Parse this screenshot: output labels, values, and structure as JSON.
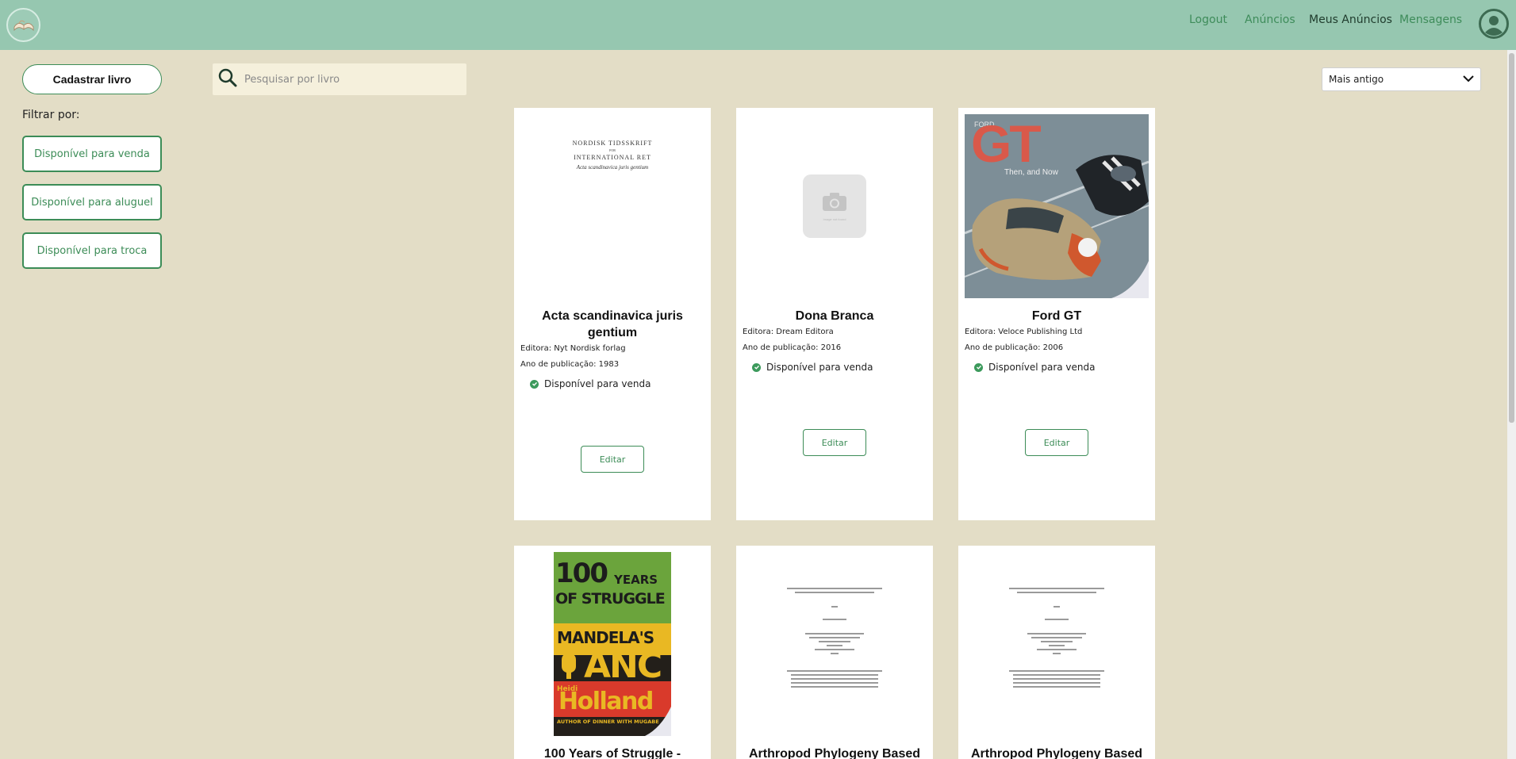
{
  "header": {
    "nav": {
      "logout": "Logout",
      "anuncios": "Anúncios",
      "meus_anuncios": "Meus Anúncios",
      "mensagens": "Mensagens"
    }
  },
  "sidebar": {
    "cadastrar_label": "Cadastrar livro",
    "filter_label": "Filtrar por:",
    "filters": [
      "Disponível para venda",
      "Disponível para aluguel",
      "Disponível para troca"
    ]
  },
  "search": {
    "placeholder": "Pesquisar por livro"
  },
  "sort": {
    "selected": "Mais antigo"
  },
  "cards": [
    {
      "title": "Acta scandinavica juris gentium",
      "editora": "Editora: Nyt Nordisk forlag",
      "ano": "Ano de publicação: 1983",
      "status": "Disponível para venda",
      "edit_label": "Editar",
      "cover": {
        "l1": "NORDISK TIDSSKRIFT",
        "l2": "FOR",
        "l3": "INTERNATIONAL RET",
        "l4": "Acta scandinavica juris gentium"
      }
    },
    {
      "title": "Dona Branca",
      "editora": "Editora: Dream Editora",
      "ano": "Ano de publicação: 2016",
      "status": "Disponível para venda",
      "edit_label": "Editar",
      "cover": {
        "tiny": "Image not found"
      }
    },
    {
      "title": "Ford GT",
      "editora": "Editora: Veloce Publishing Ltd",
      "ano": "Ano de publicação: 2006",
      "status": "Disponível para venda",
      "edit_label": "Editar",
      "cover": {
        "brand": "FORD",
        "big": "GT",
        "sub": "Then, and Now"
      }
    },
    {
      "title": "100 Years of Struggle -",
      "cover": {
        "t1": "100",
        "t2": "YEARS",
        "t3": "OF STRUGGLE",
        "t4": "MANDELA'S",
        "t5": "ANC",
        "t6": "Heidi",
        "t7": "Holland",
        "t8": "AUTHOR OF DINNER WITH MUGABE"
      }
    },
    {
      "title": "Arthropod Phylogeny Based"
    },
    {
      "title": "Arthropod Phylogeny Based"
    }
  ],
  "colors": {
    "header_bg": "#96c7b0",
    "page_bg": "#e3ddc6",
    "accent_green": "#3c8c57",
    "check_green": "#3c9a5c"
  },
  "icons": [
    "logo-icon",
    "profile-icon",
    "search-icon",
    "chevron-down-icon",
    "check-circle-icon",
    "camera-icon"
  ]
}
